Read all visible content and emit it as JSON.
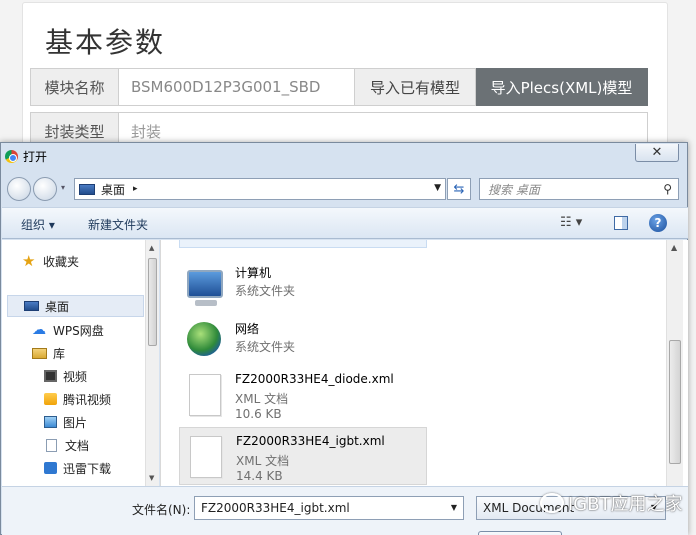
{
  "page": {
    "title": "基本参数",
    "module_label": "模块名称",
    "module_value": "BSM600D12P3G001_SBD",
    "import_existing_label": "导入已有模型",
    "import_plecs_label": "导入Plecs(XML)模型",
    "package_label": "封装类型",
    "package_placeholder": "封装"
  },
  "dialog": {
    "title": "打开",
    "close_glyph": "✕",
    "address": "桌面",
    "address_arrow": "▸",
    "search_placeholder": "搜索 桌面",
    "toolbar": {
      "organize": "组织 ▾",
      "new_folder": "新建文件夹"
    },
    "nav": {
      "favorites": "收藏夹",
      "desktop": "桌面",
      "wps": "WPS网盘",
      "library": "库",
      "videos": "视频",
      "tencent_video": "腾讯视频",
      "pictures": "图片",
      "documents": "文档",
      "xunlei": "迅雷下载"
    },
    "files": [
      {
        "name": "计算机",
        "type": "系统文件夹",
        "size": ""
      },
      {
        "name": "网络",
        "type": "系统文件夹",
        "size": ""
      },
      {
        "name": "FZ2000R33HE4_diode.xml",
        "type": "XML 文档",
        "size": "10.6 KB"
      },
      {
        "name": "FZ2000R33HE4_igbt.xml",
        "type": "XML 文档",
        "size": "14.4 KB"
      }
    ],
    "filename_label": "文件名(N):",
    "filename_value": "FZ2000R33HE4_igbt.xml",
    "filetype_value": "XML Document"
  },
  "watermark": {
    "text": "IGBT应用之家"
  },
  "colors": {
    "primary_button": "#6b7175",
    "dialog_chrome": "#d6e2f0",
    "selection": "#e5ecf6"
  }
}
